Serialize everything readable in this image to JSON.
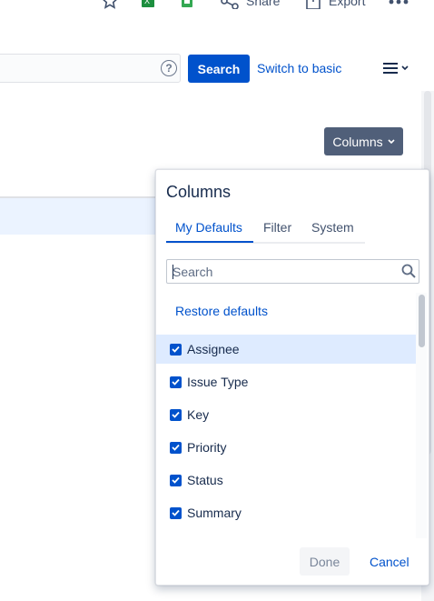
{
  "toolbar": {
    "share_label": "Share",
    "export_label": "Export",
    "excel_color": "#1d8f3f",
    "sheets_color": "#34a853"
  },
  "search_bar": {
    "jql_value": "",
    "help_symbol": "?",
    "search_label": "Search",
    "switch_label": "Switch to basic"
  },
  "columns_button": {
    "label": "Columns"
  },
  "columns_popup": {
    "title": "Columns",
    "tabs": [
      {
        "label": "My Defaults",
        "active": true
      },
      {
        "label": "Filter",
        "active": false
      },
      {
        "label": "System",
        "active": false
      }
    ],
    "search_placeholder": "Search",
    "restore_label": "Restore defaults",
    "items": [
      {
        "label": "Assignee",
        "checked": true,
        "highlighted": true
      },
      {
        "label": "Issue Type",
        "checked": true,
        "highlighted": false
      },
      {
        "label": "Key",
        "checked": true,
        "highlighted": false
      },
      {
        "label": "Priority",
        "checked": true,
        "highlighted": false
      },
      {
        "label": "Status",
        "checked": true,
        "highlighted": false
      },
      {
        "label": "Summary",
        "checked": true,
        "highlighted": false
      }
    ],
    "done_label": "Done",
    "cancel_label": "Cancel"
  },
  "colors": {
    "primary": "#0052cc",
    "columns_button_bg": "#505f79",
    "highlight": "#deebff"
  }
}
